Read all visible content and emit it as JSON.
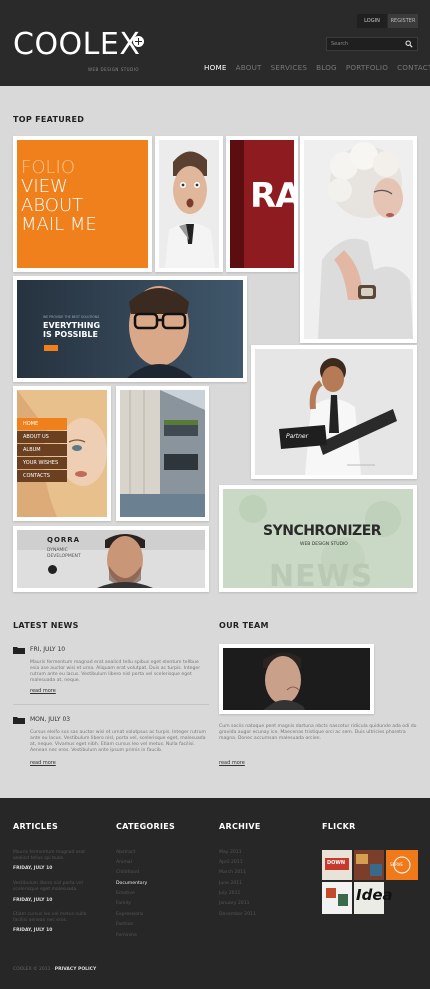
{
  "header": {
    "logo": "COOLEX",
    "tagline": "WEB DESIGN STUDIO",
    "login": "LOGIN",
    "register": "REGISTER",
    "search_placeholder": "Search",
    "nav": [
      "HOME",
      "ABOUT",
      "SERVICES",
      "BLOG",
      "PORTFOLIO",
      "CONTACTS"
    ]
  },
  "featured": {
    "title": "TOP FEATURED",
    "folio_lines": [
      "FOLIO",
      "VIEW",
      "ABOUT",
      "MAIL ME"
    ],
    "ra_text": "RA",
    "everything_small": "WE PROVIDE THE BEST SOLUTIONS",
    "everything_lines": [
      "EVERYTHING",
      "IS POSSIBLE"
    ],
    "menu_items": [
      "HOME",
      "ABOUT US",
      "ALBUM",
      "YOUR WISHES",
      "CONTACTS"
    ],
    "partner": "Partner",
    "qorra": "QORRA",
    "qorra_sub": [
      "DYNAMIC",
      "DEVELOPMENT"
    ],
    "synchronizer": "SYNCHRONIZER",
    "synchronizer_sub": "WEB DESIGN STUDIO",
    "news_word": "NEWS"
  },
  "latest_news": {
    "title": "LATEST NEWS",
    "items": [
      {
        "date": "FRI, JULY 10",
        "text": "Mauris fermentum magnad erat aealicd tellu spibus eget elentum tellbue esia ase auctor wisi et urna. Aliquam erat volutpat. Duis ac turpis. Integer rutrum ante eu lacus. Vestibulum libero nisl porta vel scelerisque eget malesuada at, neque.",
        "link": "read more"
      },
      {
        "date": "MON, JULY 03",
        "text": "Cursus eleifo sus sas auctor wisi et urnat volutpsus ac turpis. Integer rutrum ante eu lacus. Vestibulum libero nisl, porta vel, scelerisque eget, malesuada at, neque. Vivamus eget nibh. Etiam cursus leo vel metus. Nulla facilisi. Aenean nec eros. Vestibulum ante ipsum primis in faucib.",
        "link": "read more"
      }
    ]
  },
  "our_team": {
    "title": "OUR TEAM",
    "text": "Cum sociis natoque pent magnis dartuna nbcts nascetur ridicula quidunde ada odi do gravida augor ecunay ice. Maecenas tristique orci ac sem. Duis ultricies pharetra magna. Donec accumsan malesuada orcien.",
    "link": "read more"
  },
  "footer": {
    "articles_title": "ARTICLES",
    "articles": [
      {
        "text": "Mauris fermentum magnad erat aealicd tellus spi buse.",
        "date": "FRIDAY, JULY 10"
      },
      {
        "text": "Vestibulum libero nisl porta vel scelerisque eget malesuada.",
        "date": "FRIDAY, JULY 10"
      },
      {
        "text": "Etiam cursus leo vel metus nulla facilisi aenean nec eros.",
        "date": "FRIDAY, JULY 10"
      }
    ],
    "categories_title": "CATEGORIES",
    "categories": [
      "Abstract",
      "Animal",
      "Childhood",
      "Documentary",
      "Emotive",
      "Family",
      "Expressions",
      "Fashion",
      "Feminine"
    ],
    "archive_title": "ARCHIVE",
    "archive": [
      "May 2011",
      "April 2011",
      "March 2011",
      "June 2011",
      "July 2011",
      "January 2011",
      "December 2011"
    ],
    "flickr_title": "FLICKR",
    "flickr_labels": [
      "DOWN",
      "SERVE",
      "Idea"
    ],
    "copyright": "COOLEX © 2011",
    "privacy": "PRIVACY POLICY"
  },
  "colors": {
    "orange": "#f0801c",
    "dark": "#2a2a2a",
    "red": "#8e1b1f"
  }
}
